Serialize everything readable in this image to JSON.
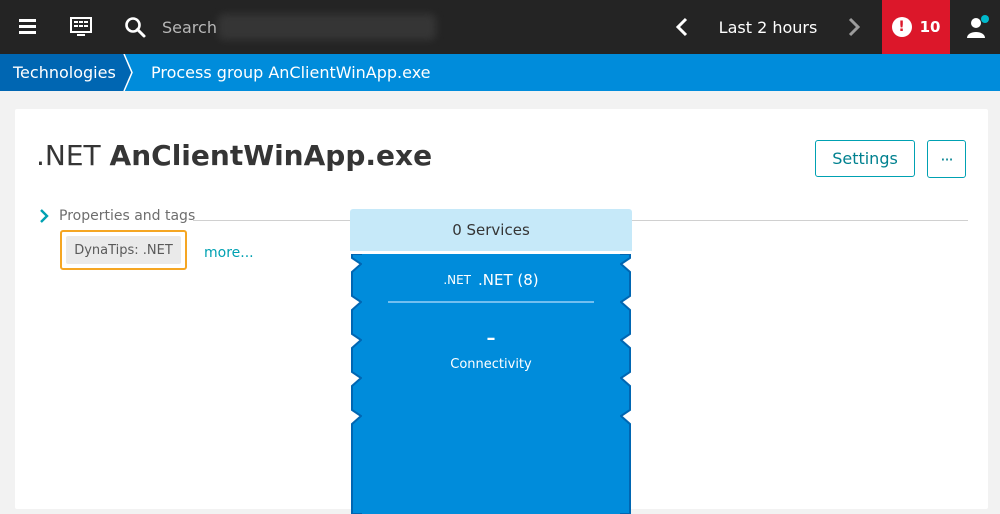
{
  "topbar": {
    "search_placeholder": "Search",
    "timeframe": "Last 2 hours",
    "problems_count": "10",
    "problems_icon": "!"
  },
  "breadcrumb": {
    "home": "Technologies",
    "current": "Process group AnClientWinApp.exe"
  },
  "header": {
    "title_prefix": ".NET",
    "title_name": "AnClientWinApp.exe",
    "settings_label": "Settings",
    "more_label": "···"
  },
  "properties": {
    "label": "Properties and tags",
    "dynatip": "DynaTips: .NET",
    "more_link": "more..."
  },
  "process_group": {
    "services_label": "0 Services",
    "tech_icon_text": ".NET",
    "tech_label": ".NET (8)",
    "connectivity_value": "–",
    "connectivity_label": "Connectivity"
  },
  "colors": {
    "topbar": "#242424",
    "breadcrumb": "#008cdb",
    "breadcrumb_home": "#0066b2",
    "problems": "#dc172a",
    "accent_teal": "#00a1b2",
    "dynatip_highlight": "#f5a623",
    "services_bg": "#c6e9f9",
    "process_group_bg": "#008cdb"
  }
}
